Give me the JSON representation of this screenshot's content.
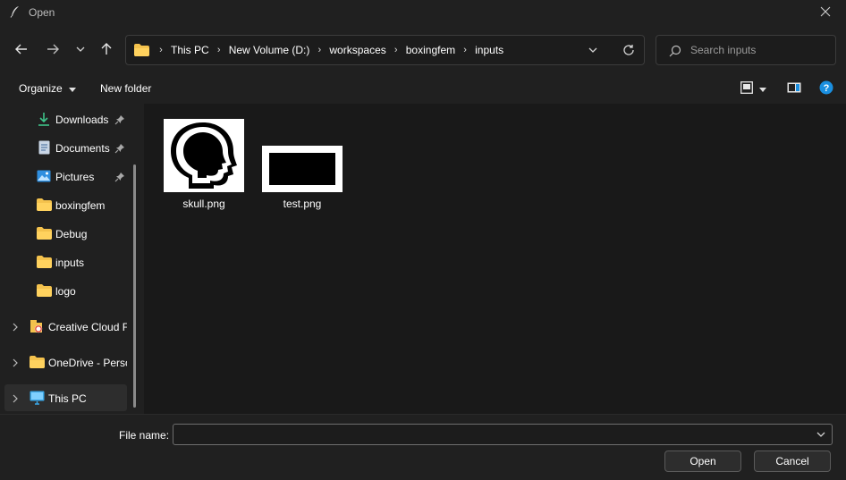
{
  "window": {
    "title": "Open",
    "icon": "feather-icon"
  },
  "nav": {
    "back": "arrow-left-icon",
    "forward": "arrow-right-icon",
    "recent": "chevron-down-icon",
    "up": "arrow-up-icon"
  },
  "address": {
    "crumbs": [
      "This PC",
      "New Volume (D:)",
      "workspaces",
      "boxingfem",
      "inputs"
    ]
  },
  "search": {
    "placeholder": "Search inputs"
  },
  "commands": {
    "organize": "Organize",
    "new_folder": "New folder"
  },
  "sidebar": {
    "items": [
      {
        "label": "Downloads",
        "icon": "download-icon",
        "pinned": true
      },
      {
        "label": "Documents",
        "icon": "document-icon",
        "pinned": true
      },
      {
        "label": "Pictures",
        "icon": "pictures-icon",
        "pinned": true
      },
      {
        "label": "boxingfem",
        "icon": "folder-icon"
      },
      {
        "label": "Debug",
        "icon": "folder-icon"
      },
      {
        "label": "inputs",
        "icon": "folder-icon"
      },
      {
        "label": "logo",
        "icon": "folder-icon"
      },
      {
        "label": "Creative Cloud F",
        "icon": "creative-cloud-folder-icon"
      },
      {
        "label": "OneDrive - Perso",
        "icon": "folder-icon"
      },
      {
        "label": "This PC",
        "icon": "monitor-icon",
        "selected": true
      }
    ]
  },
  "files": [
    {
      "name": "skull.png",
      "thumbnail": "skull-silhouette"
    },
    {
      "name": "test.png",
      "thumbnail": "black-rectangle"
    }
  ],
  "footer": {
    "file_name_label": "File name:",
    "file_name_value": "",
    "open_label": "Open",
    "cancel_label": "Cancel"
  },
  "colors": {
    "background": "#202020",
    "content_bg": "#191919",
    "folder_yellow": "#f4c24d",
    "accent_blue": "#1a8fe0",
    "selection": "#2d2d2d"
  }
}
